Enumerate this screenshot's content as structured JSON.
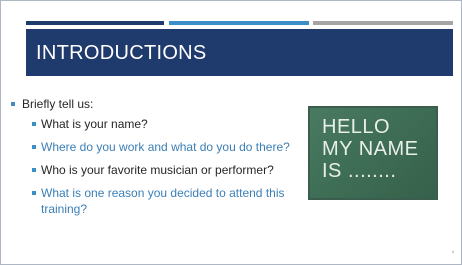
{
  "colors": {
    "title_band": "#1f3a6d",
    "accent_navy": "#1f3a6d",
    "accent_blue": "#3b8fc6",
    "accent_gray": "#a5a5a5",
    "bullet": "#3b8fc6",
    "text_dark": "#262626",
    "text_blue": "#3b7fb6",
    "chalkboard": "#3f6e56",
    "chalk": "#e8efe9"
  },
  "slide": {
    "title": "INTRODUCTIONS",
    "intro": "Briefly tell us:",
    "items": [
      {
        "text": "What is your name?",
        "style": "dark"
      },
      {
        "text": "Where do you work and what do you do there?",
        "style": "blue"
      },
      {
        "text": "Who is your favorite musician or performer?",
        "style": "dark"
      },
      {
        "text": "What is one reason you decided to attend this training?",
        "style": "blue"
      }
    ],
    "chalkboard_lines": [
      "HELLO",
      "MY NAME",
      "IS ........"
    ],
    "slide_number": "4"
  }
}
